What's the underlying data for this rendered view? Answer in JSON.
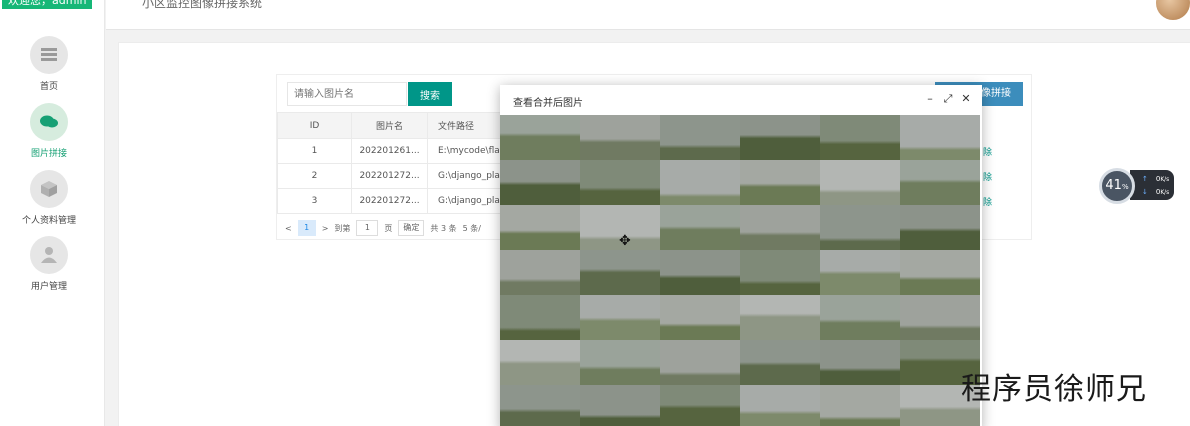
{
  "header": {
    "welcome": "欢迎您，admin",
    "title": "小区监控图像拼接系统"
  },
  "sidebar": {
    "items": [
      {
        "label": "首页",
        "icon": "home-icon"
      },
      {
        "label": "图片拼接",
        "icon": "chat-icon",
        "active": true
      },
      {
        "label": "个人资料管理",
        "icon": "cube-icon"
      },
      {
        "label": "用户管理",
        "icon": "user-icon"
      }
    ]
  },
  "toolbar": {
    "search_placeholder": "请输入图片名",
    "search_label": "搜索",
    "stitch_label": "像拼接"
  },
  "table": {
    "columns": [
      "ID",
      "图片名",
      "文件路径"
    ],
    "rows": [
      {
        "id": "1",
        "name": "202201261...",
        "path": "E:\\mycode\\flas"
      },
      {
        "id": "2",
        "name": "202201272...",
        "path": "G:\\django_plat"
      },
      {
        "id": "3",
        "name": "202201272...",
        "path": "G:\\django_plat"
      }
    ],
    "row_action": "除"
  },
  "pager": {
    "prev": "<",
    "current": "1",
    "next": ">",
    "goto": "到第",
    "page_value": "1",
    "page_unit": "页",
    "confirm": "确定",
    "total": "共 3 条",
    "size": "5 条/"
  },
  "modal": {
    "title": "查看合并后图片",
    "minimize": "–",
    "maximize": "⤢",
    "close": "✕",
    "cursor": "✥"
  },
  "status_widget": {
    "cpu": "41",
    "cpu_unit": "%",
    "up": "0",
    "down": "0",
    "rate_unit": "K/s"
  },
  "watermark": "程序员徐师兄",
  "colors": {
    "primary": "#009688",
    "accent": "#16b777",
    "blue_button": "#3c8dbc"
  }
}
